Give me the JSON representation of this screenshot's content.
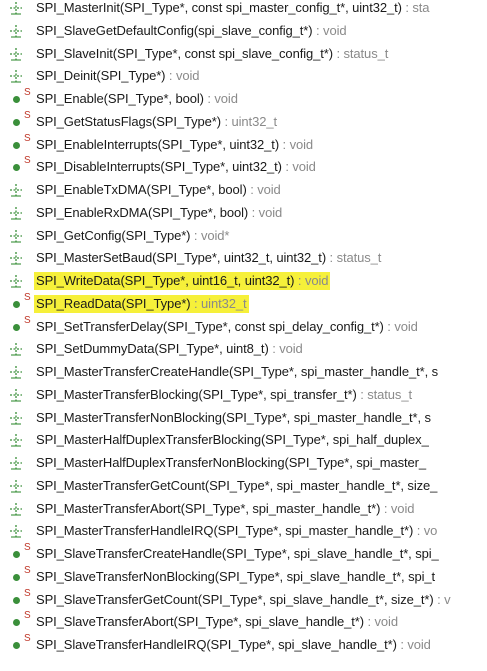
{
  "outline": {
    "rows": [
      {
        "icon": "declaration-icon",
        "name": "SPI_MasterInit",
        "sig": "SPI_MasterInit(SPI_Type*, const spi_master_config_t*, uint32_t)",
        "ret": " : sta",
        "static": false,
        "highlight": false
      },
      {
        "icon": "declaration-icon",
        "name": "SPI_SlaveGetDefaultConfig",
        "sig": "SPI_SlaveGetDefaultConfig(spi_slave_config_t*)",
        "ret": " : void",
        "static": false,
        "highlight": false
      },
      {
        "icon": "declaration-icon",
        "name": "SPI_SlaveInit",
        "sig": "SPI_SlaveInit(SPI_Type*, const spi_slave_config_t*)",
        "ret": " : status_t",
        "static": false,
        "highlight": false
      },
      {
        "icon": "declaration-icon",
        "name": "SPI_Deinit",
        "sig": "SPI_Deinit(SPI_Type*)",
        "ret": " : void",
        "static": false,
        "highlight": false
      },
      {
        "icon": "method-icon",
        "name": "SPI_Enable",
        "sig": "SPI_Enable(SPI_Type*, bool)",
        "ret": " : void",
        "static": true,
        "highlight": false
      },
      {
        "icon": "method-icon",
        "name": "SPI_GetStatusFlags",
        "sig": "SPI_GetStatusFlags(SPI_Type*)",
        "ret": " : uint32_t",
        "static": true,
        "highlight": false
      },
      {
        "icon": "method-icon",
        "name": "SPI_EnableInterrupts",
        "sig": "SPI_EnableInterrupts(SPI_Type*, uint32_t)",
        "ret": " : void",
        "static": true,
        "highlight": false
      },
      {
        "icon": "method-icon",
        "name": "SPI_DisableInterrupts",
        "sig": "SPI_DisableInterrupts(SPI_Type*, uint32_t)",
        "ret": " : void",
        "static": true,
        "highlight": false
      },
      {
        "icon": "declaration-icon",
        "name": "SPI_EnableTxDMA",
        "sig": "SPI_EnableTxDMA(SPI_Type*, bool)",
        "ret": " : void",
        "static": false,
        "highlight": false
      },
      {
        "icon": "declaration-icon",
        "name": "SPI_EnableRxDMA",
        "sig": "SPI_EnableRxDMA(SPI_Type*, bool)",
        "ret": " : void",
        "static": false,
        "highlight": false
      },
      {
        "icon": "declaration-icon",
        "name": "SPI_GetConfig",
        "sig": "SPI_GetConfig(SPI_Type*)",
        "ret": " : void*",
        "static": false,
        "highlight": false
      },
      {
        "icon": "declaration-icon",
        "name": "SPI_MasterSetBaud",
        "sig": "SPI_MasterSetBaud(SPI_Type*, uint32_t, uint32_t)",
        "ret": " : status_t",
        "static": false,
        "highlight": false
      },
      {
        "icon": "declaration-icon",
        "name": "SPI_WriteData",
        "sig": "SPI_WriteData(SPI_Type*, uint16_t, uint32_t)",
        "ret": " : void",
        "static": false,
        "highlight": true
      },
      {
        "icon": "method-icon",
        "name": "SPI_ReadData",
        "sig": "SPI_ReadData(SPI_Type*)",
        "ret": " : uint32_t",
        "static": true,
        "highlight": true
      },
      {
        "icon": "method-icon",
        "name": "SPI_SetTransferDelay",
        "sig": "SPI_SetTransferDelay(SPI_Type*, const spi_delay_config_t*)",
        "ret": " : void",
        "static": true,
        "highlight": false
      },
      {
        "icon": "declaration-icon",
        "name": "SPI_SetDummyData",
        "sig": "SPI_SetDummyData(SPI_Type*, uint8_t)",
        "ret": " : void",
        "static": false,
        "highlight": false
      },
      {
        "icon": "declaration-icon",
        "name": "SPI_MasterTransferCreateHandle",
        "sig": "SPI_MasterTransferCreateHandle(SPI_Type*, spi_master_handle_t*, s",
        "ret": "",
        "static": false,
        "highlight": false
      },
      {
        "icon": "declaration-icon",
        "name": "SPI_MasterTransferBlocking",
        "sig": "SPI_MasterTransferBlocking(SPI_Type*, spi_transfer_t*)",
        "ret": " : status_t",
        "static": false,
        "highlight": false
      },
      {
        "icon": "declaration-icon",
        "name": "SPI_MasterTransferNonBlocking",
        "sig": "SPI_MasterTransferNonBlocking(SPI_Type*, spi_master_handle_t*, s",
        "ret": "",
        "static": false,
        "highlight": false
      },
      {
        "icon": "declaration-icon",
        "name": "SPI_MasterHalfDuplexTransferBlocking",
        "sig": "SPI_MasterHalfDuplexTransferBlocking(SPI_Type*, spi_half_duplex_",
        "ret": "",
        "static": false,
        "highlight": false
      },
      {
        "icon": "declaration-icon",
        "name": "SPI_MasterHalfDuplexTransferNonBlocking",
        "sig": "SPI_MasterHalfDuplexTransferNonBlocking(SPI_Type*, spi_master_",
        "ret": "",
        "static": false,
        "highlight": false
      },
      {
        "icon": "declaration-icon",
        "name": "SPI_MasterTransferGetCount",
        "sig": "SPI_MasterTransferGetCount(SPI_Type*, spi_master_handle_t*, size_",
        "ret": "",
        "static": false,
        "highlight": false
      },
      {
        "icon": "declaration-icon",
        "name": "SPI_MasterTransferAbort",
        "sig": "SPI_MasterTransferAbort(SPI_Type*, spi_master_handle_t*)",
        "ret": " : void",
        "static": false,
        "highlight": false
      },
      {
        "icon": "declaration-icon",
        "name": "SPI_MasterTransferHandleIRQ",
        "sig": "SPI_MasterTransferHandleIRQ(SPI_Type*, spi_master_handle_t*)",
        "ret": " : vo",
        "static": false,
        "highlight": false
      },
      {
        "icon": "method-icon",
        "name": "SPI_SlaveTransferCreateHandle",
        "sig": "SPI_SlaveTransferCreateHandle(SPI_Type*, spi_slave_handle_t*, spi_",
        "ret": "",
        "static": true,
        "highlight": false
      },
      {
        "icon": "method-icon",
        "name": "SPI_SlaveTransferNonBlocking",
        "sig": "SPI_SlaveTransferNonBlocking(SPI_Type*, spi_slave_handle_t*, spi_t",
        "ret": "",
        "static": true,
        "highlight": false
      },
      {
        "icon": "method-icon",
        "name": "SPI_SlaveTransferGetCount",
        "sig": "SPI_SlaveTransferGetCount(SPI_Type*, spi_slave_handle_t*, size_t*)",
        "ret": " : v",
        "static": true,
        "highlight": false
      },
      {
        "icon": "method-icon",
        "name": "SPI_SlaveTransferAbort",
        "sig": "SPI_SlaveTransferAbort(SPI_Type*, spi_slave_handle_t*)",
        "ret": " : void",
        "static": true,
        "highlight": false
      },
      {
        "icon": "method-icon",
        "name": "SPI_SlaveTransferHandleIRQ",
        "sig": "SPI_SlaveTransferHandleIRQ(SPI_Type*, spi_slave_handle_t*)",
        "ret": " : void",
        "static": true,
        "highlight": false
      }
    ],
    "static_marker": "S"
  },
  "colors": {
    "highlight": "#f6f03a",
    "return_type": "#8a8a8a",
    "method_dot": "#3a8f3a",
    "static_badge": "#c0392b",
    "declaration_icon": "#3a8f3a"
  }
}
